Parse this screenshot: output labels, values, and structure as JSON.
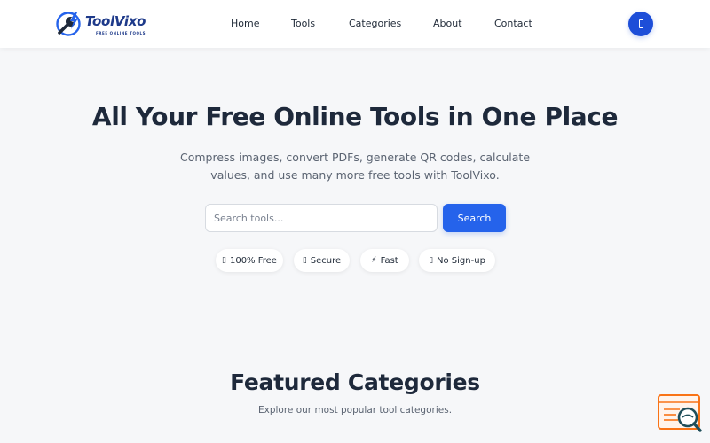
{
  "brand": {
    "name": "ToolVixo",
    "tagline": "FREE ONLINE TOOLS",
    "primary_color": "#2563eb",
    "logo_icon": "wrench-lightning-icon"
  },
  "nav": {
    "items": [
      {
        "label": "Home"
      },
      {
        "label": "Tools"
      },
      {
        "label": "Categories"
      },
      {
        "label": "About"
      },
      {
        "label": "Contact"
      }
    ],
    "theme_toggle_icon": "theme-toggle-icon"
  },
  "hero": {
    "title": "All Your Free Online Tools in One Place",
    "subtitle": "Compress images, convert PDFs, generate QR codes, calculate values, and use many more free tools with ToolVixo.",
    "search": {
      "placeholder": "Search tools...",
      "value": "",
      "button_label": "Search"
    },
    "badges": [
      {
        "icon": "check-icon",
        "glyph": "▯",
        "label": "100% Free"
      },
      {
        "icon": "lock-icon",
        "glyph": "▯",
        "label": "Secure"
      },
      {
        "icon": "lightning-icon",
        "glyph": "⚡",
        "label": "Fast"
      },
      {
        "icon": "user-icon",
        "glyph": "▯",
        "label": "No Sign-up"
      }
    ]
  },
  "featured": {
    "title": "Featured Categories",
    "subtitle": "Explore our most popular tool categories."
  },
  "chat_widget": {
    "icon": "chat-search-icon",
    "accent_color": "#f97316",
    "secondary_color": "#1f4e5a"
  }
}
